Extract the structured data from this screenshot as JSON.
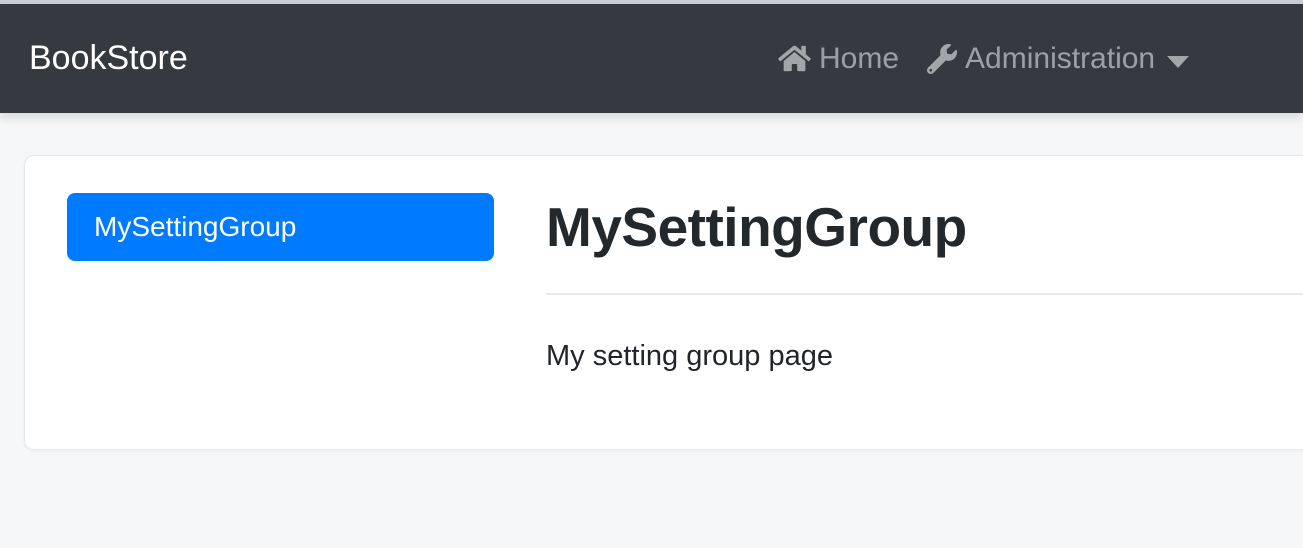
{
  "app": {
    "brand": "BookStore"
  },
  "navbar": {
    "items": [
      {
        "label": "Home",
        "icon": "home-icon"
      },
      {
        "label": "Administration",
        "icon": "wrench-icon",
        "has_dropdown": true
      }
    ]
  },
  "settings": {
    "tabs": [
      {
        "label": "MySettingGroup",
        "active": true
      }
    ],
    "page": {
      "title": "MySettingGroup",
      "body": "My setting group page"
    }
  },
  "colors": {
    "navbar_bg": "#343a40",
    "primary_accent": "#007bff",
    "page_bg": "#f6f7f9",
    "nav_link_text": "rgba(255,255,255,0.52)",
    "heading_text": "#23282d"
  }
}
